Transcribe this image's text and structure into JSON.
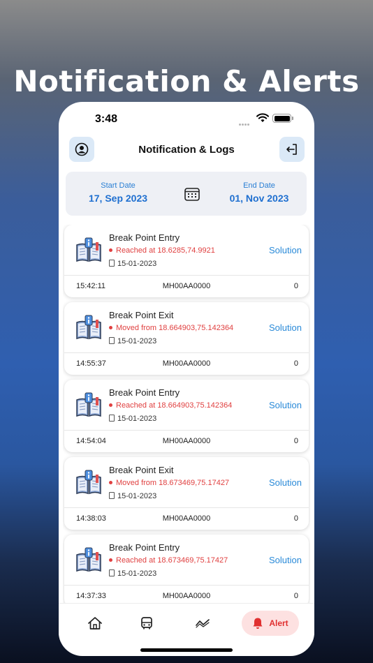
{
  "promo": {
    "title": "Notification & Alerts"
  },
  "status_bar": {
    "time": "3:48"
  },
  "header": {
    "title": "Notification & Logs",
    "left_icon": "user-icon",
    "right_icon": "logout-icon"
  },
  "date_range": {
    "start_label": "Start Date",
    "start_value": "17, Sep 2023",
    "end_label": "End Date",
    "end_value": "01, Nov 2023",
    "calendar_icon": "calendar-icon"
  },
  "notifications": [
    {
      "title": "Break Point Entry",
      "location": "Reached at 18.6285,74.9921",
      "date": "15-01-2023",
      "action": "Solution",
      "time": "15:42:11",
      "vehicle": "MH00AA0000",
      "count": "0"
    },
    {
      "title": "Break Point Exit",
      "location": "Moved from 18.664903,75.142364",
      "date": "15-01-2023",
      "action": "Solution",
      "time": "14:55:37",
      "vehicle": "MH00AA0000",
      "count": "0"
    },
    {
      "title": "Break Point Entry",
      "location": "Reached at 18.664903,75.142364",
      "date": "15-01-2023",
      "action": "Solution",
      "time": "14:54:04",
      "vehicle": "MH00AA0000",
      "count": "0"
    },
    {
      "title": "Break Point Exit",
      "location": "Moved from 18.673469,75.17427",
      "date": "15-01-2023",
      "action": "Solution",
      "time": "14:38:03",
      "vehicle": "MH00AA0000",
      "count": "0"
    },
    {
      "title": "Break Point Entry",
      "location": "Reached at 18.673469,75.17427",
      "date": "15-01-2023",
      "action": "Solution",
      "time": "14:37:33",
      "vehicle": "MH00AA0000",
      "count": "0"
    }
  ],
  "tab_bar": {
    "items": [
      {
        "name": "home",
        "icon": "home-icon"
      },
      {
        "name": "bus",
        "icon": "bus-icon"
      },
      {
        "name": "route",
        "icon": "route-icon"
      },
      {
        "name": "alert",
        "icon": "bell-icon",
        "label": "Alert",
        "active": true
      }
    ]
  },
  "colors": {
    "accent": "#1e6fd0",
    "alert": "#e03030",
    "icon_bg": "#dbe9f7"
  }
}
